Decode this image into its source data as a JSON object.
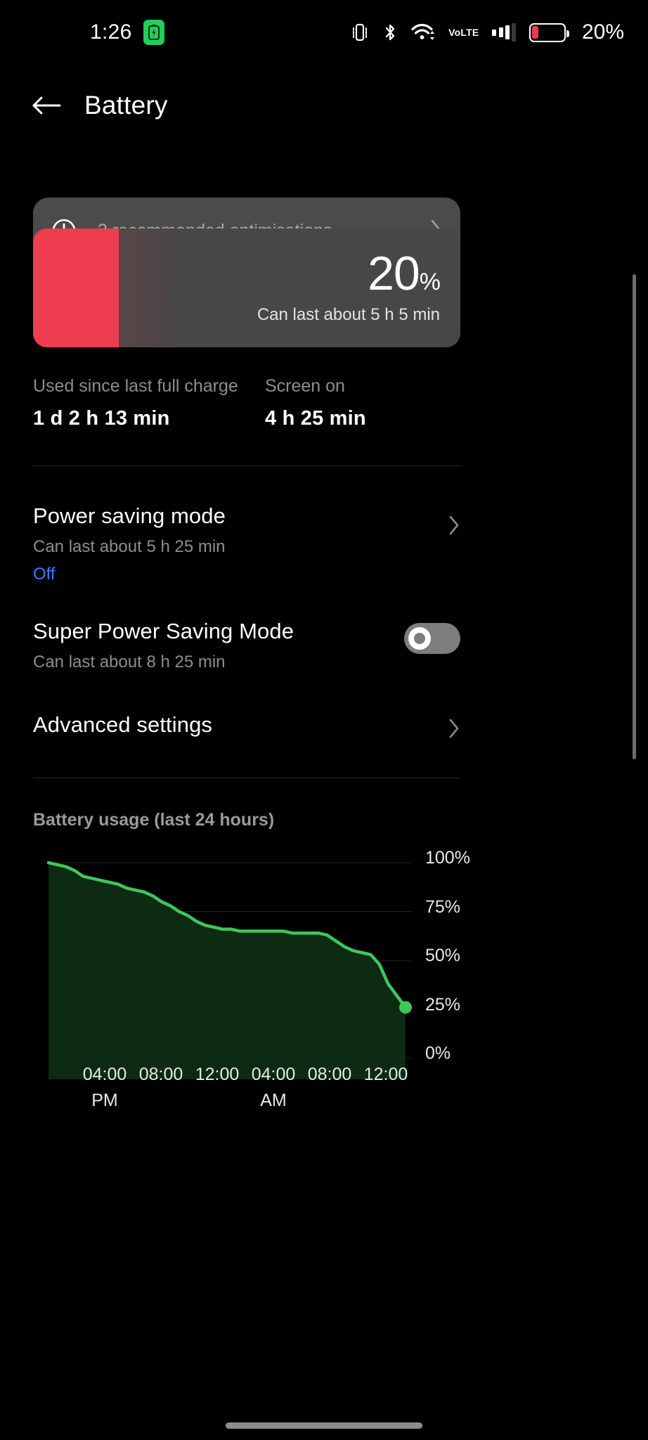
{
  "statusbar": {
    "clock": "1:26",
    "battery_percent": "20%",
    "icons": [
      "vibrate-icon",
      "bluetooth-icon",
      "wifi-icon",
      "volte-icon",
      "signal-bars-icon",
      "battery-icon"
    ],
    "volte_top": "Vo",
    "volte_bottom": "LTE",
    "battery_fill_pct": 20,
    "chip_icon": "green-battery-chip-icon"
  },
  "appbar": {
    "back_icon": "back-arrow-icon",
    "title": "Battery"
  },
  "banner": {
    "icon": "exclamation-circle-icon",
    "text": "3 recommended optimisations",
    "chevron": "chevron-right-icon"
  },
  "battery_card": {
    "percent_number": "20",
    "percent_symbol": "%",
    "subtitle": "Can last about 5 h 5 min",
    "fill_color": "#ee3d51",
    "track_color": "#474747",
    "fill_ratio": 0.2
  },
  "stats": [
    {
      "label": "Used since last full charge",
      "value": "1 d 2 h 13 min"
    },
    {
      "label": "Screen on",
      "value": "4 h 25 min"
    }
  ],
  "rows": {
    "power_saving": {
      "title": "Power saving mode",
      "subtitle": "Can last about 5 h 25 min",
      "state": "Off",
      "state_color": "#3b7ff5",
      "chevron": "chevron-right-icon"
    },
    "super_power_saving": {
      "title": "Super Power Saving Mode",
      "subtitle": "Can last about 8 h 25 min",
      "toggle_state": "off"
    },
    "advanced": {
      "title": "Advanced settings",
      "chevron": "chevron-right-icon"
    }
  },
  "chart_section": {
    "title": "Battery usage (last 24 hours)"
  },
  "chart_data": {
    "type": "area",
    "title": "Battery usage (last 24 hours)",
    "xlabel": "",
    "ylabel": "",
    "ylim": [
      0,
      100
    ],
    "yticks": [
      0,
      25,
      50,
      75,
      100
    ],
    "ytick_labels": [
      "0%",
      "25%",
      "50%",
      "75%",
      "100%"
    ],
    "xtick_labels": [
      "04:00",
      "08:00",
      "12:00",
      "04:00",
      "08:00",
      "12:00"
    ],
    "xtick_sublabels": [
      "PM",
      "",
      "",
      "AM",
      "",
      ""
    ],
    "grid": true,
    "line_color": "#3ec75a",
    "fill_color": "#0d2a13",
    "endpoint_marker": true,
    "endpoint_value": 26,
    "x": [
      0,
      0.6,
      1.2,
      1.8,
      2.4,
      3.0,
      3.6,
      4.2,
      4.8,
      5.4,
      6.0,
      6.6,
      7.2,
      7.8,
      8.4,
      9.0,
      9.6,
      10.2,
      10.8,
      11.4,
      12.0,
      12.6,
      13.2,
      13.8,
      14.4,
      15.0,
      15.6,
      16.2,
      16.8,
      17.4,
      18.0,
      18.6,
      19.2,
      19.8,
      20.4,
      21.0,
      21.6,
      22.2,
      22.8,
      23.4,
      24.0
    ],
    "values": [
      100,
      99,
      98,
      96,
      93,
      92,
      91,
      90,
      89,
      87,
      86,
      85,
      83,
      80,
      78,
      75,
      73,
      70,
      68,
      67,
      66,
      66,
      65,
      65,
      65,
      65,
      65,
      65,
      64,
      64,
      64,
      64,
      63,
      60,
      57,
      55,
      54,
      53,
      48,
      38,
      32,
      26
    ]
  },
  "scrollbar": {
    "name": "page-scrollbar"
  }
}
